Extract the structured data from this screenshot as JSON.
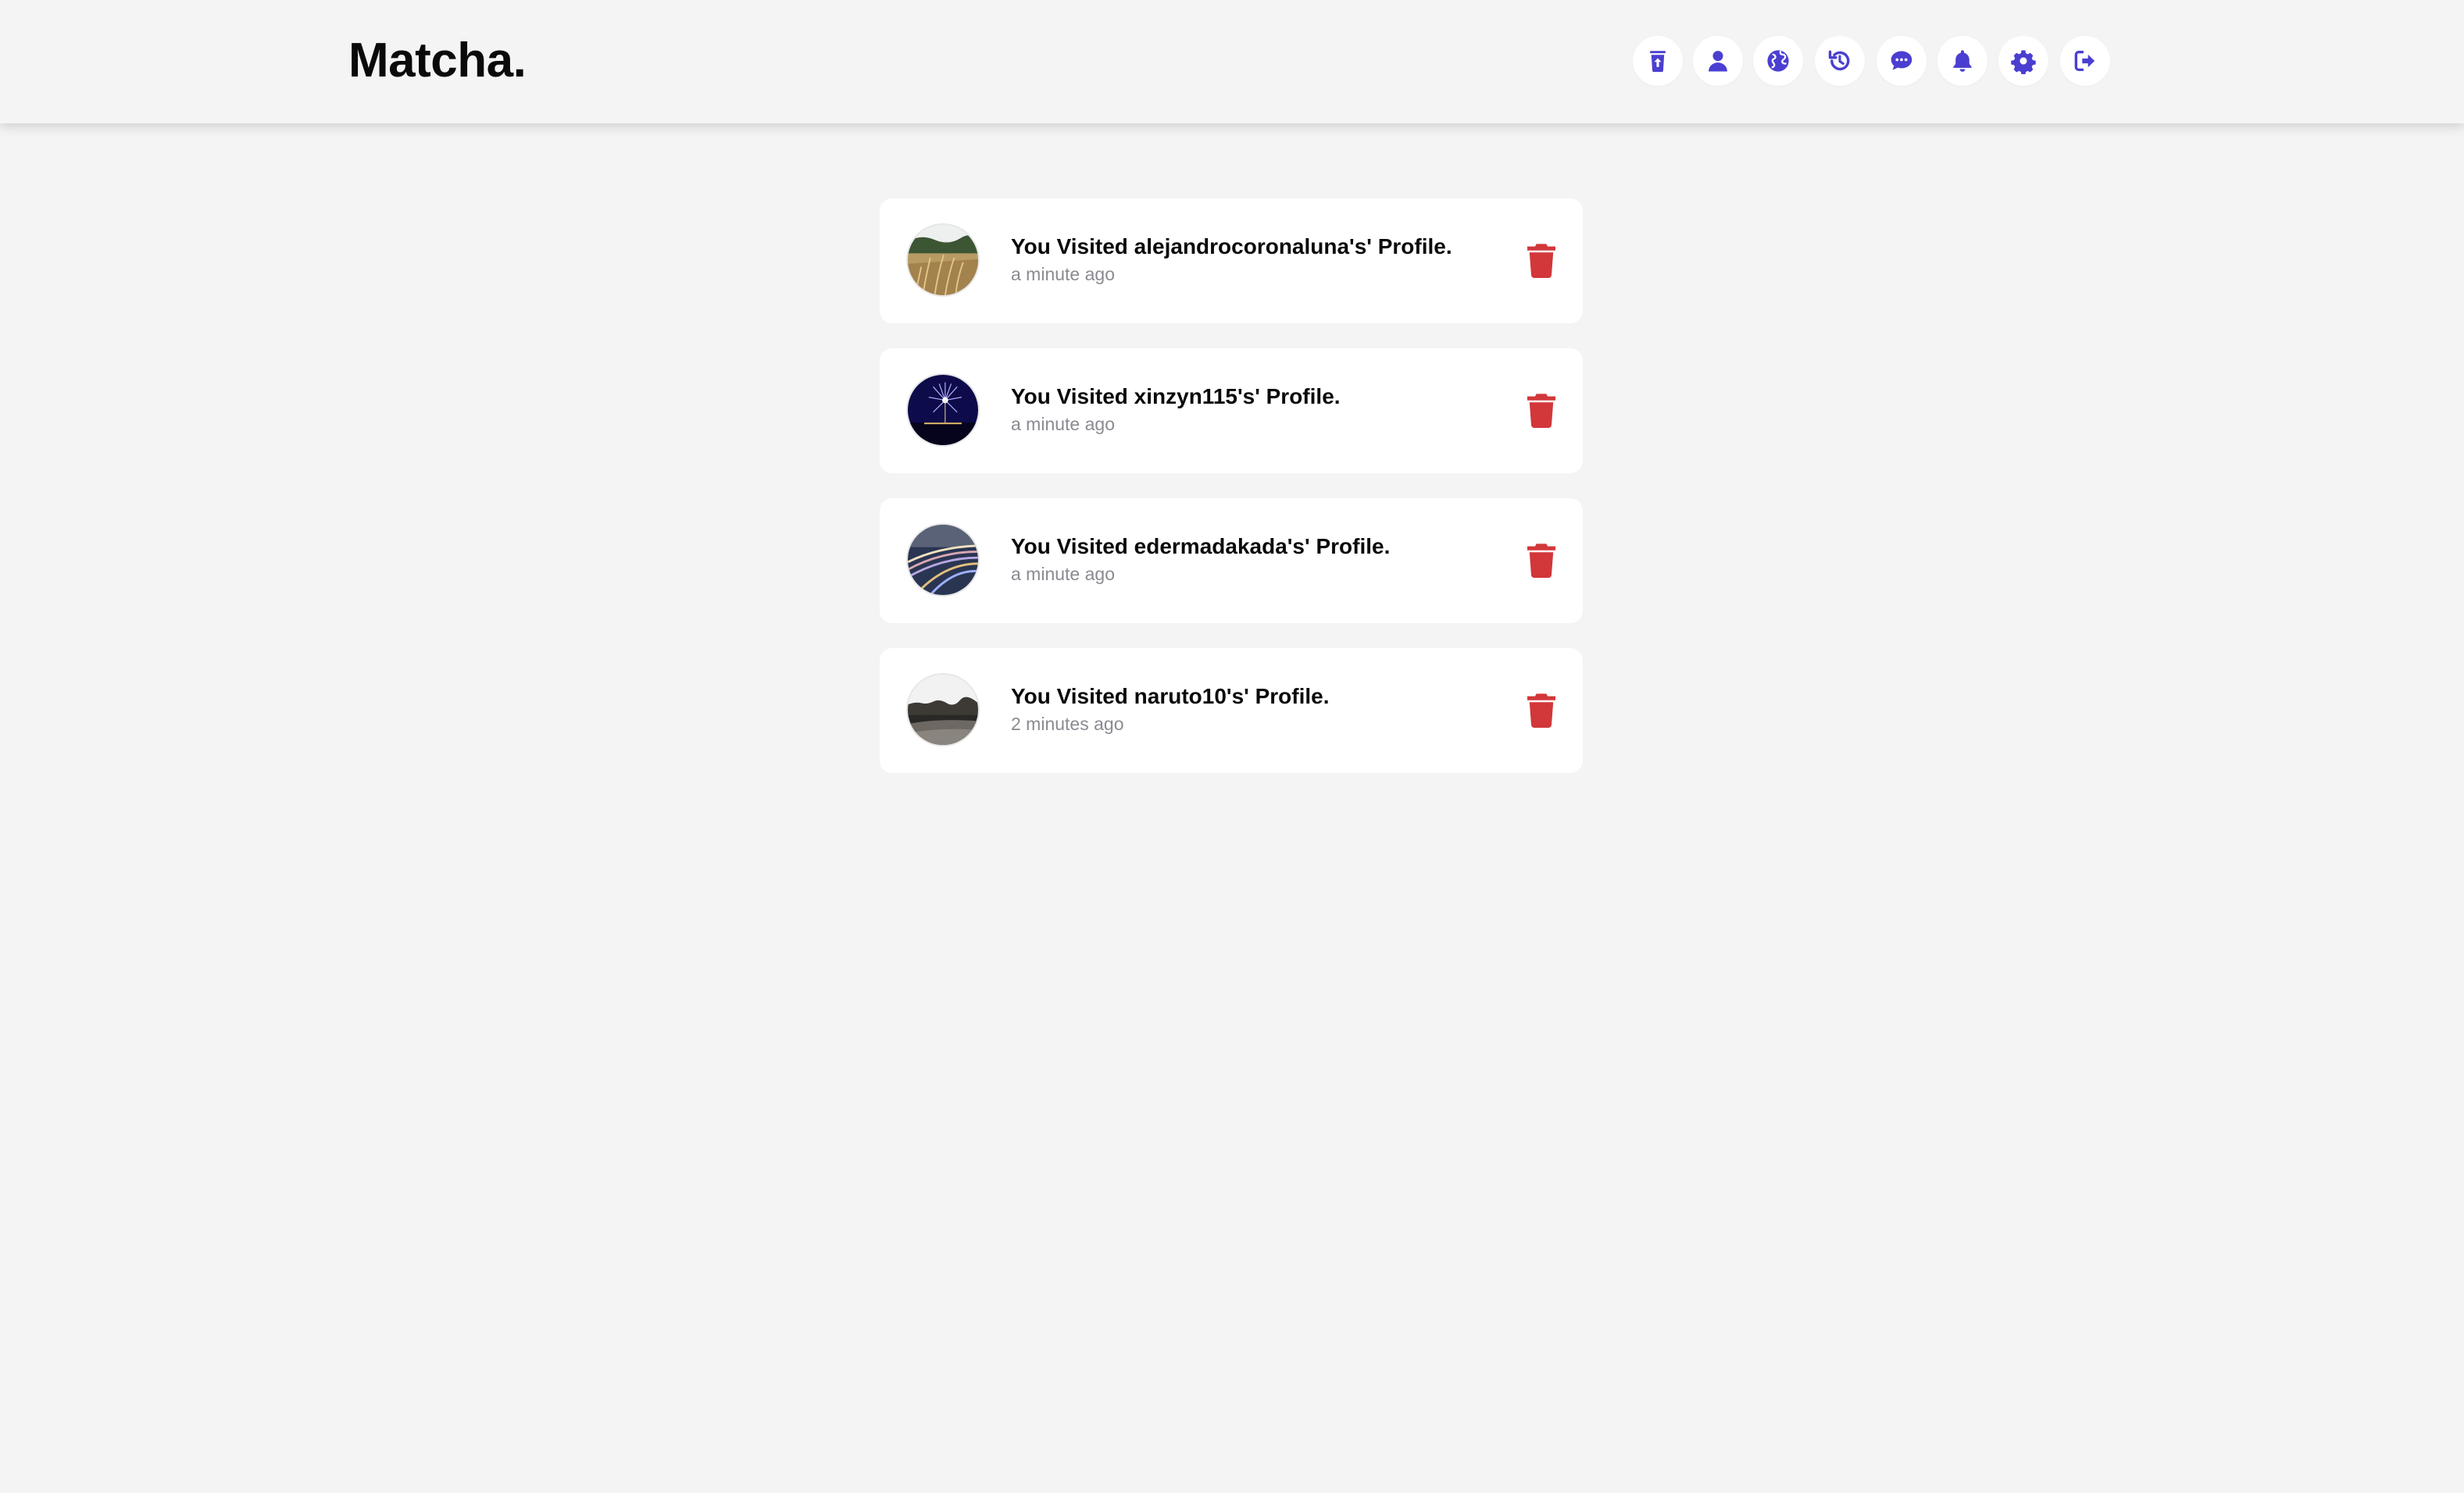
{
  "app": {
    "brand": "Matcha."
  },
  "nav": {
    "items": [
      {
        "name": "upload-icon"
      },
      {
        "name": "user-icon"
      },
      {
        "name": "globe-icon"
      },
      {
        "name": "history-icon"
      },
      {
        "name": "chat-icon"
      },
      {
        "name": "bell-icon"
      },
      {
        "name": "gear-icon"
      },
      {
        "name": "logout-icon"
      }
    ],
    "accent_color": "#4b3fd1"
  },
  "history": {
    "items": [
      {
        "title": "You Visited alejandrocoronaluna's' Profile.",
        "time": "a minute ago",
        "avatar": "wheat-field-photo"
      },
      {
        "title": "You Visited xinzyn115's' Profile.",
        "time": "a minute ago",
        "avatar": "fireworks-photo"
      },
      {
        "title": "You Visited edermadakada's' Profile.",
        "time": "a minute ago",
        "avatar": "light-trails-photo"
      },
      {
        "title": "You Visited naruto10's' Profile.",
        "time": "2 minutes ago",
        "avatar": "landscape-photo"
      }
    ],
    "delete_color": "#d2373a"
  }
}
